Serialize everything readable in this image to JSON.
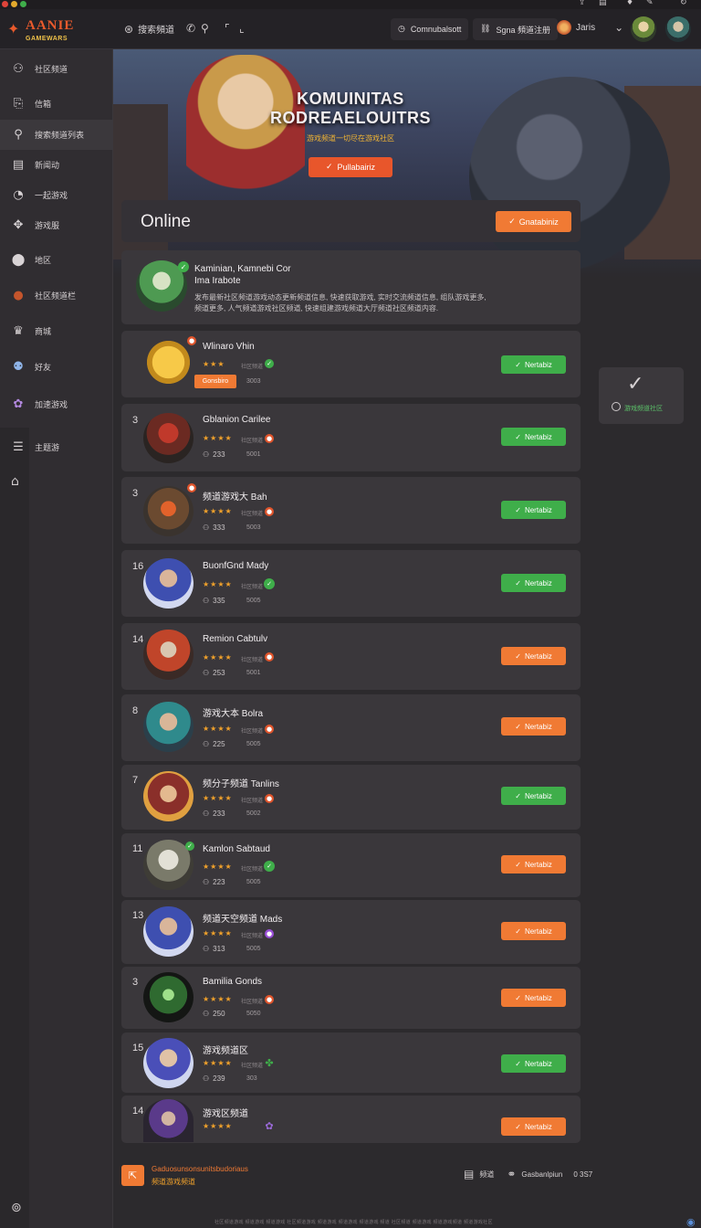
{
  "app": {
    "logo_line1": "AANIE",
    "logo_line2": "GAMEWARS",
    "search_label": "搜索頻道",
    "top_right": {
      "community_label": "Comnubalsott",
      "signin_label": "Sgna 頻道注册",
      "user_name": "Jaris"
    }
  },
  "sidebar": {
    "items": [
      {
        "label": "社区频道",
        "icon": "controller-icon"
      },
      {
        "label": "信箱",
        "icon": "book-icon"
      },
      {
        "label": "搜索频道列表",
        "icon": "search-icon"
      },
      {
        "label": "新闻动",
        "icon": "layout-icon"
      },
      {
        "label": "一起游戏",
        "icon": "clock-icon"
      },
      {
        "label": "游戏服",
        "icon": "gamepad-icon"
      },
      {
        "label": "地区",
        "icon": "pin-icon"
      },
      {
        "label": "社区频道栏",
        "icon": "avatar-icon"
      },
      {
        "label": "商城",
        "icon": "gift-icon"
      },
      {
        "label": "好友",
        "icon": "friends-icon"
      },
      {
        "label": "加速游戏",
        "icon": "flower-icon"
      },
      {
        "label": "主题游",
        "icon": "menu-icon"
      }
    ]
  },
  "hero": {
    "title_line1": "KOMUINITAS",
    "title_line2": "RODREAELOUITRS",
    "subtitle": "游戏频道一切尽在游戏社区",
    "cta_label": "Pullabairiz"
  },
  "online": {
    "title": "Online",
    "button_label": "Gnatabiniz"
  },
  "featured": {
    "name": "Kaminian, Kamnebi Cor",
    "subname": "Ima Irabote",
    "desc_line1": "发布最新社区频道游戏动态更新频道信息, 快速获取游戏, 实时交流频道信息, 组队游戏更多,",
    "desc_line2": "频道更多, 人气频道游戏社区频道, 快速组建游戏频道大厅频道社区频道内容."
  },
  "rows": [
    {
      "rank": "",
      "name": "Wlinaro Vhin",
      "stars": "★★★",
      "level": "社区频道",
      "count": "Gonsbiro",
      "score": "3003",
      "status": "ok",
      "action": "Nertabiz",
      "action_color": "green",
      "tag": true
    },
    {
      "rank": "3",
      "name": "Gblanion Carilee",
      "stars": "★★★★",
      "level": "社区频道",
      "count": "233",
      "score": "5001",
      "status": "live",
      "action": "Nertabiz",
      "action_color": "green"
    },
    {
      "rank": "3",
      "name": "频道游戏大 Bah",
      "stars": "★★★★",
      "level": "社区频道",
      "count": "333",
      "score": "5003",
      "status": "live",
      "action": "Nertabiz",
      "action_color": "green"
    },
    {
      "rank": "16",
      "name": "BuonfGnd Mady",
      "stars": "★★★★",
      "level": "社区频道",
      "count": "335",
      "score": "5005",
      "status": "ok",
      "action": "Nertabiz",
      "action_color": "green"
    },
    {
      "rank": "14",
      "name": "Remion Cabtulv",
      "stars": "★★★★",
      "level": "社区频道",
      "count": "253",
      "score": "5001",
      "status": "live",
      "action": "Nertabiz",
      "action_color": "orange"
    },
    {
      "rank": "8",
      "name": "游戏大本 Bolra",
      "stars": "★★★★",
      "level": "社区频道",
      "count": "225",
      "score": "5005",
      "status": "live",
      "action": "Nertabiz",
      "action_color": "orange"
    },
    {
      "rank": "7",
      "name": "频分子频道 Tanlins",
      "stars": "★★★★",
      "level": "社区频道",
      "count": "233",
      "score": "5002",
      "status": "live",
      "action": "Nertabiz",
      "action_color": "green"
    },
    {
      "rank": "11",
      "name": "Kamlon Sabtaud",
      "stars": "★★★★",
      "level": "社区频道",
      "count": "223",
      "score": "5005",
      "status": "ok",
      "action": "Nertabiz",
      "action_color": "orange"
    },
    {
      "rank": "13",
      "name": "频道天空频道 Mads",
      "stars": "★★★★",
      "level": "社区频道",
      "count": "313",
      "score": "5005",
      "status": "purple",
      "action": "Nertabiz",
      "action_color": "orange"
    },
    {
      "rank": "3",
      "name": "Bamilia Gonds",
      "stars": "★★★★",
      "level": "社区频道",
      "count": "250",
      "score": "5050",
      "status": "live",
      "action": "Nertabiz",
      "action_color": "orange"
    },
    {
      "rank": "15",
      "name": "游戏频道区",
      "stars": "★★★★",
      "level": "社区频道",
      "count": "239",
      "score": "303",
      "status": "leaf",
      "action": "Nertabiz",
      "action_color": "green"
    },
    {
      "rank": "14",
      "name": "游戏区频道",
      "stars": "★★★★",
      "level": "",
      "count": "",
      "score": "",
      "status": "flower",
      "action": "Nertabiz",
      "action_color": "orange"
    }
  ],
  "float_card": {
    "label": "游戏频道社区"
  },
  "footer": {
    "line1": "Gaduosunsonsunitsbudoriaus",
    "line2": "频道游戏频道",
    "right_label": "频道",
    "right_link": "Gasbanlpiun",
    "right_num": "0 3S7"
  },
  "bottom": {
    "text": "社区频道游戏 频道游戏 频道游戏 社区频道游戏 频道游戏 频道游戏 频道游戏 频道 社区频道 频道游戏 频道游戏频道 频道游戏社区"
  },
  "colors": {
    "accent_orange": "#f07a34",
    "accent_green": "#3fae4a",
    "background": "#2c2a2d",
    "card": "#3a373b"
  }
}
